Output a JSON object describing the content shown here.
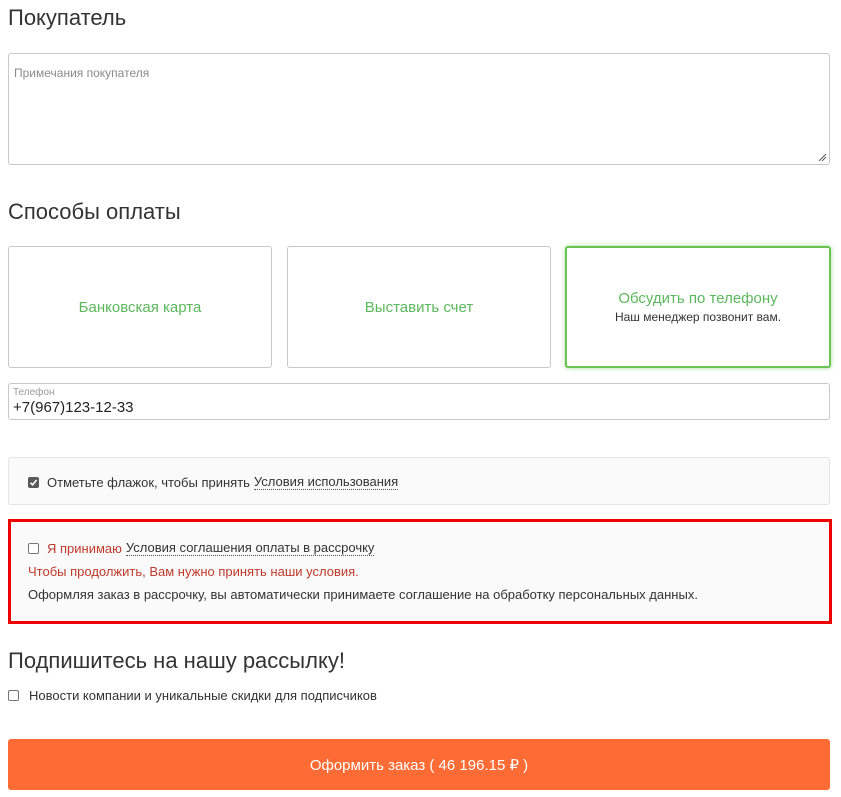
{
  "buyer": {
    "title": "Покупатель",
    "notes_placeholder": "Примечания покупателя",
    "notes_value": ""
  },
  "payment": {
    "title": "Способы оплаты",
    "methods": [
      {
        "label": "Банковская карта",
        "sub": "",
        "selected": false
      },
      {
        "label": "Выставить счет",
        "sub": "",
        "selected": false
      },
      {
        "label": "Обсудить по телефону",
        "sub": "Наш менеджер позвонит вам.",
        "selected": true
      }
    ],
    "phone_label": "Телефон",
    "phone_value": "+7(967)123-12-33"
  },
  "terms": {
    "checked": true,
    "text": "Отметьте флажок, чтобы принять",
    "link": "Условия использования"
  },
  "installment": {
    "checked": false,
    "text": "Я принимаю",
    "link": "Условия соглашения оплаты в рассрочку",
    "error": "Чтобы продолжить, Вам нужно принять наши условия.",
    "info": "Оформляя заказ в рассрочку, вы автоматически принимаете соглашение на обработку персональных данных."
  },
  "newsletter": {
    "title": "Подпишитесь на нашу рассылку!",
    "checked": false,
    "label": "Новости компании и уникальные скидки для подписчиков"
  },
  "submit": {
    "label": "Оформить заказ ( 46 196.15 ₽ )"
  },
  "colors": {
    "accent_green": "#5cb85c",
    "error_red": "#c0392b",
    "highlight_border": "#ee0000",
    "submit_orange": "#ff6b35"
  }
}
